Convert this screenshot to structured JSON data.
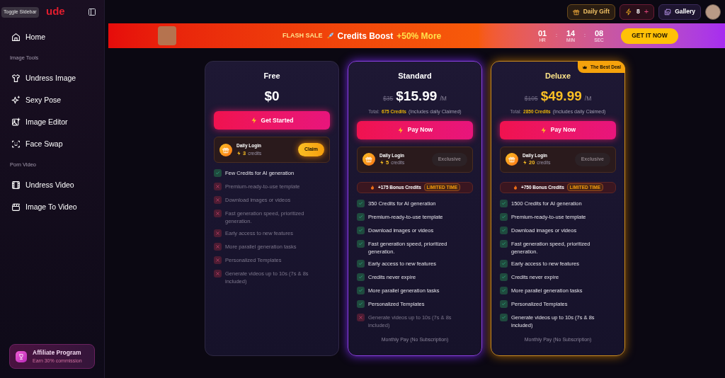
{
  "sidebar": {
    "logo": "ude",
    "tooltip": "Toggle Sidebar",
    "items": [
      {
        "kind": "link",
        "label": "Home"
      },
      {
        "kind": "section",
        "label": "Image Tools"
      },
      {
        "kind": "link",
        "label": "Undress Image"
      },
      {
        "kind": "link",
        "label": "Sexy Pose"
      },
      {
        "kind": "link",
        "label": "Image Editor"
      },
      {
        "kind": "link",
        "label": "Face Swap"
      },
      {
        "kind": "section",
        "label": "Porn Video"
      },
      {
        "kind": "link",
        "label": "Undress Video"
      },
      {
        "kind": "link",
        "label": "Image To Video"
      }
    ],
    "affiliate": {
      "title": "Affiliate Program",
      "subtitle": "Earn 30% commission"
    }
  },
  "topbar": {
    "daily_gift": "Daily Gift",
    "credits": "8",
    "plus": "+",
    "gallery": "Gallery"
  },
  "banner": {
    "flash": "FLASH SALE",
    "title": "Credits Boost",
    "highlight": "+50% More",
    "separator": ":",
    "countdown": [
      {
        "value": "01",
        "unit": "HR"
      },
      {
        "value": "14",
        "unit": "MIN"
      },
      {
        "value": "08",
        "unit": "SEC"
      }
    ],
    "cta": "GET IT NOW"
  },
  "plans": [
    {
      "name": "Free",
      "kind": "basic",
      "price": "$0",
      "button": "Get Started",
      "daily": {
        "title": "Daily Login",
        "amount": "3",
        "unit": "credits",
        "action": "Claim",
        "disabled": false
      },
      "features": [
        {
          "text": "Few Credits for AI generation",
          "included": true
        },
        {
          "text": "Premium-ready-to-use template",
          "included": false
        },
        {
          "text": "Download images or videos",
          "included": false
        },
        {
          "text": "Fast generation speed, prioritized generation.",
          "included": false
        },
        {
          "text": "Early access to new features",
          "included": false
        },
        {
          "text": "More parallel generation tasks",
          "included": false
        },
        {
          "text": "Personalized Templates",
          "included": false
        },
        {
          "text": "Generate videos up to 10s (7s & 8s included)",
          "included": false
        }
      ]
    },
    {
      "name": "Standard",
      "kind": "popular",
      "old_price": "$35",
      "price": "$15.99",
      "period": "/M",
      "total_label": "Total:",
      "total_credits": "675 Credits",
      "total_note": "(Includes daily Claimed)",
      "button": "Pay Now",
      "daily": {
        "title": "Daily Login",
        "amount": "5",
        "unit": "credits",
        "action": "Exclusive",
        "disabled": true
      },
      "bonus": {
        "text": "+175 Bonus Credits",
        "tag": "LIMITED TIME"
      },
      "features": [
        {
          "text": "350 Credits for AI generation",
          "included": true
        },
        {
          "text": "Premium-ready-to-use template",
          "included": true
        },
        {
          "text": "Download images or videos",
          "included": true
        },
        {
          "text": "Fast generation speed, prioritized generation.",
          "included": true
        },
        {
          "text": "Early access to new features",
          "included": true
        },
        {
          "text": "Credits never expire",
          "included": true
        },
        {
          "text": "More parallel generation tasks",
          "included": true
        },
        {
          "text": "Personalized Templates",
          "included": true
        },
        {
          "text": "Generate videos up to 10s (7s & 8s included)",
          "included": false
        }
      ],
      "footer": "Monthly Pay (No Subscription)"
    },
    {
      "name": "Deluxe",
      "kind": "best",
      "badge": "The Best Deal",
      "old_price": "$105",
      "price": "$49.99",
      "period": "/M",
      "total_label": "Total:",
      "total_credits": "2850 Credits",
      "total_note": "(Includes daily Claimed)",
      "button": "Pay Now",
      "daily": {
        "title": "Daily Login",
        "amount": "20",
        "unit": "credits",
        "action": "Exclusive",
        "disabled": true
      },
      "bonus": {
        "text": "+750 Bonus Credits",
        "tag": "LIMITED TIME"
      },
      "features": [
        {
          "text": "1500 Credits for AI generation",
          "included": true
        },
        {
          "text": "Premium-ready-to-use template",
          "included": true
        },
        {
          "text": "Download images or videos",
          "included": true
        },
        {
          "text": "Fast generation speed, prioritized generation.",
          "included": true
        },
        {
          "text": "Early access to new features",
          "included": true
        },
        {
          "text": "Credits never expire",
          "included": true
        },
        {
          "text": "More parallel generation tasks",
          "included": true
        },
        {
          "text": "Personalized Templates",
          "included": true
        },
        {
          "text": "Generate videos up to 10s (7s & 8s included)",
          "included": true
        }
      ],
      "footer": "Monthly Pay (No Subscription)"
    }
  ]
}
